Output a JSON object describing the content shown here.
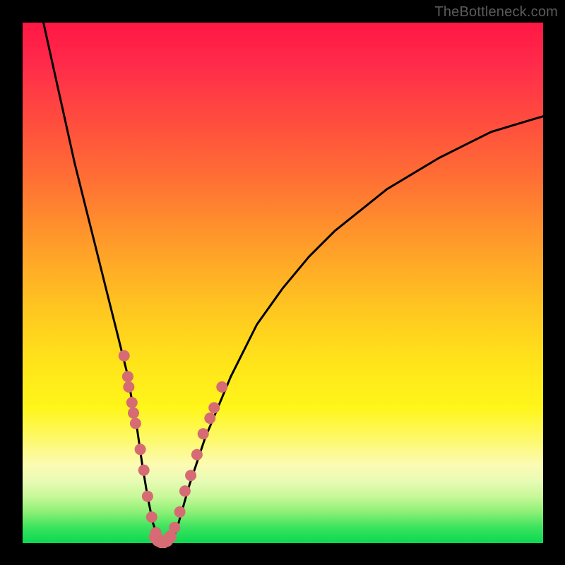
{
  "watermark": "TheBottleneck.com",
  "chart_data": {
    "type": "line",
    "title": "",
    "xlabel": "",
    "ylabel": "",
    "xlim": [
      0,
      100
    ],
    "ylim": [
      0,
      100
    ],
    "series": [
      {
        "name": "bottleneck-curve",
        "x": [
          4,
          6,
          8,
          10,
          12,
          14,
          16,
          18,
          20,
          22,
          23,
          24,
          25,
          26,
          27,
          28,
          29,
          30,
          32,
          35,
          40,
          45,
          50,
          55,
          60,
          65,
          70,
          75,
          80,
          85,
          90,
          95,
          100
        ],
        "values": [
          100,
          91,
          82,
          73,
          65,
          57,
          49,
          41,
          33,
          22,
          15,
          9,
          4,
          1,
          0,
          0,
          1,
          4,
          11,
          20,
          32,
          42,
          49,
          55,
          60,
          64,
          68,
          71,
          74,
          76.5,
          79,
          80.5,
          82
        ]
      }
    ],
    "markers": {
      "name": "highlight-dots",
      "color": "#d76b73",
      "points": [
        {
          "x": 19.5,
          "y": 36
        },
        {
          "x": 20.2,
          "y": 32
        },
        {
          "x": 20.4,
          "y": 30
        },
        {
          "x": 21.0,
          "y": 27
        },
        {
          "x": 21.3,
          "y": 25
        },
        {
          "x": 21.7,
          "y": 23
        },
        {
          "x": 22.6,
          "y": 18
        },
        {
          "x": 23.3,
          "y": 14
        },
        {
          "x": 24.0,
          "y": 9
        },
        {
          "x": 24.8,
          "y": 5
        },
        {
          "x": 25.6,
          "y": 2
        },
        {
          "x": 26.2,
          "y": 0.7
        },
        {
          "x": 27.0,
          "y": 0.3
        },
        {
          "x": 27.8,
          "y": 0.4
        },
        {
          "x": 28.5,
          "y": 1.2
        },
        {
          "x": 29.2,
          "y": 3
        },
        {
          "x": 30.2,
          "y": 6
        },
        {
          "x": 31.2,
          "y": 10
        },
        {
          "x": 32.3,
          "y": 13
        },
        {
          "x": 33.5,
          "y": 17
        },
        {
          "x": 34.7,
          "y": 21
        },
        {
          "x": 36.0,
          "y": 24
        },
        {
          "x": 36.8,
          "y": 26
        },
        {
          "x": 38.3,
          "y": 30
        }
      ]
    }
  }
}
